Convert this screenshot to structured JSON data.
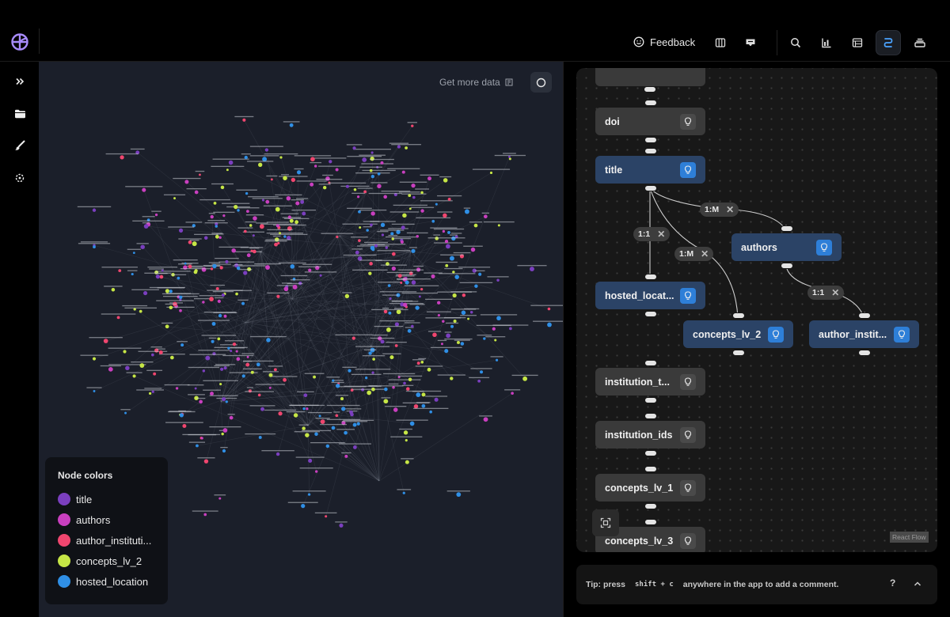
{
  "app": {
    "brand_color": "#a78bfa"
  },
  "topbar": {
    "feedback_label": "Feedback",
    "icons": [
      "logo-icon",
      "smile-icon",
      "columns-icon",
      "inbox-icon",
      "search-icon",
      "bar-chart-icon",
      "table-icon",
      "schema-icon",
      "stack-icon"
    ],
    "active_tool": "schema-icon"
  },
  "leftrail": {
    "icons": [
      "chevrons-right-icon",
      "folder-icon",
      "brush-icon",
      "target-icon"
    ]
  },
  "graph": {
    "get_more_label": "Get more data",
    "background": "#1b1f2a",
    "legend": {
      "title": "Node colors",
      "items": [
        {
          "label": "title",
          "color": "#7b3fbf"
        },
        {
          "label": "authors",
          "color": "#c93fbf"
        },
        {
          "label": "author_instituti...",
          "color": "#f0466f"
        },
        {
          "label": "concepts_lv_2",
          "color": "#c6e646"
        },
        {
          "label": "hosted_location",
          "color": "#2f8fe6"
        }
      ]
    }
  },
  "schema_flow": {
    "nodes": [
      {
        "id": "doi",
        "label": "doi",
        "linked": false
      },
      {
        "id": "title",
        "label": "title",
        "linked": true
      },
      {
        "id": "authors",
        "label": "authors",
        "linked": true
      },
      {
        "id": "hosted_location",
        "label": "hosted_locat...",
        "linked": true
      },
      {
        "id": "concepts_lv_2",
        "label": "concepts_lv_2",
        "linked": true
      },
      {
        "id": "author_institutions",
        "label": "author_instit...",
        "linked": true
      },
      {
        "id": "institution_types",
        "label": "institution_t...",
        "linked": false
      },
      {
        "id": "institution_ids",
        "label": "institution_ids",
        "linked": false
      },
      {
        "id": "concepts_lv_1",
        "label": "concepts_lv_1",
        "linked": false
      },
      {
        "id": "concepts_lv_3",
        "label": "concepts_lv_3",
        "linked": false
      }
    ],
    "edges": [
      {
        "from": "title",
        "to": "authors",
        "label": "1:M"
      },
      {
        "from": "title",
        "to": "hosted_location",
        "label": "1:1"
      },
      {
        "from": "title",
        "to": "concepts_lv_2",
        "label": "1:M"
      },
      {
        "from": "authors",
        "to": "author_institutions",
        "label": "1:1"
      }
    ],
    "attribution": "React Flow"
  },
  "tip": {
    "prefix": "Tip: press",
    "keys": "shift + c",
    "suffix": "anywhere in the app to add a comment.",
    "help": "?"
  }
}
